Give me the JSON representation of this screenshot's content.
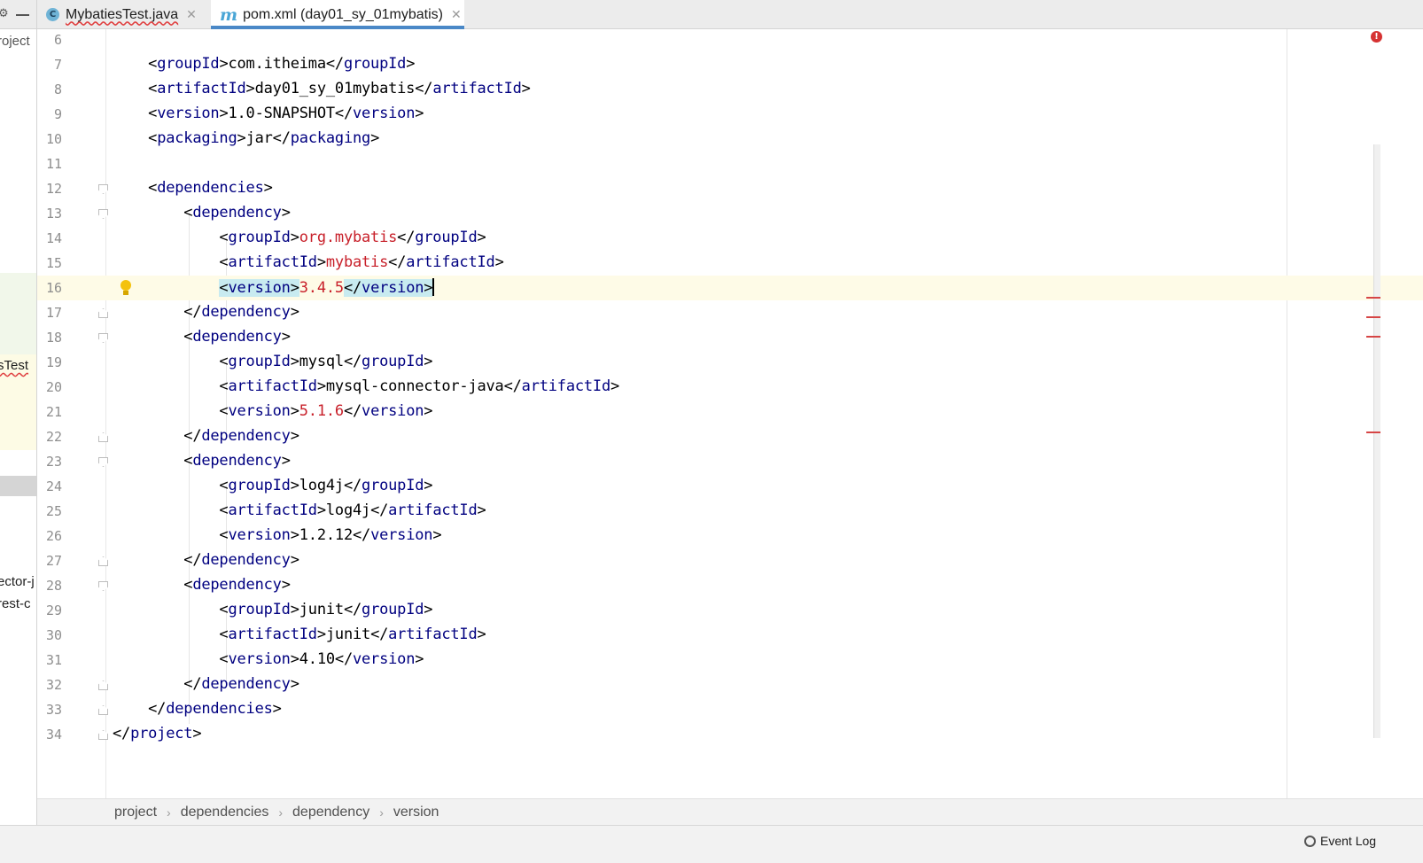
{
  "tabs": [
    {
      "label": "MybatiesTest.java",
      "icon": "java-class-icon",
      "active": false
    },
    {
      "label": "pom.xml (day01_sy_01mybatis)",
      "icon": "maven-m-icon",
      "active": true
    }
  ],
  "left_panel": {
    "fragments": [
      "roject",
      "sTest",
      "ector-j",
      "rest-c"
    ]
  },
  "editor": {
    "lines": [
      {
        "num": "6"
      },
      {
        "num": "7"
      },
      {
        "num": "8"
      },
      {
        "num": "9"
      },
      {
        "num": "10"
      },
      {
        "num": "11"
      },
      {
        "num": "12"
      },
      {
        "num": "13"
      },
      {
        "num": "14"
      },
      {
        "num": "15"
      },
      {
        "num": "16"
      },
      {
        "num": "17"
      },
      {
        "num": "18"
      },
      {
        "num": "19"
      },
      {
        "num": "20"
      },
      {
        "num": "21"
      },
      {
        "num": "22"
      },
      {
        "num": "23"
      },
      {
        "num": "24"
      },
      {
        "num": "25"
      },
      {
        "num": "26"
      },
      {
        "num": "27"
      },
      {
        "num": "28"
      },
      {
        "num": "29"
      },
      {
        "num": "30"
      },
      {
        "num": "31"
      },
      {
        "num": "32"
      },
      {
        "num": "33"
      },
      {
        "num": "34"
      }
    ],
    "values": {
      "groupId": "com.itheima",
      "artifactId": "day01_sy_01mybatis",
      "version": "1.0-SNAPSHOT",
      "packaging": "jar",
      "dep1_groupId": "org.mybatis",
      "dep1_artifactId": "mybatis",
      "dep1_version": "3.4.5",
      "dep2_groupId": "mysql",
      "dep2_artifactId": "mysql-connector-java",
      "dep2_version": "5.1.6",
      "dep3_groupId": "log4j",
      "dep3_artifactId": "log4j",
      "dep3_version": "1.2.12",
      "dep4_groupId": "junit",
      "dep4_artifactId": "junit",
      "dep4_version": "4.10"
    },
    "tags": {
      "groupId": "groupId",
      "artifactId": "artifactId",
      "version": "version",
      "packaging": "packaging",
      "dependencies": "dependencies",
      "dependency": "dependency",
      "project": "project"
    },
    "current_line": "16",
    "error_indicator": "!"
  },
  "breadcrumb": [
    "project",
    "dependencies",
    "dependency",
    "version"
  ],
  "statusbar": {
    "event_log_label": "Event Log"
  },
  "colors": {
    "tag": "#000080",
    "value_highlight": "#c8202a",
    "tab_underline": "#4a88c7",
    "current_line_bg": "#fefbe7",
    "tag_match_bg": "#c8ebf0"
  }
}
